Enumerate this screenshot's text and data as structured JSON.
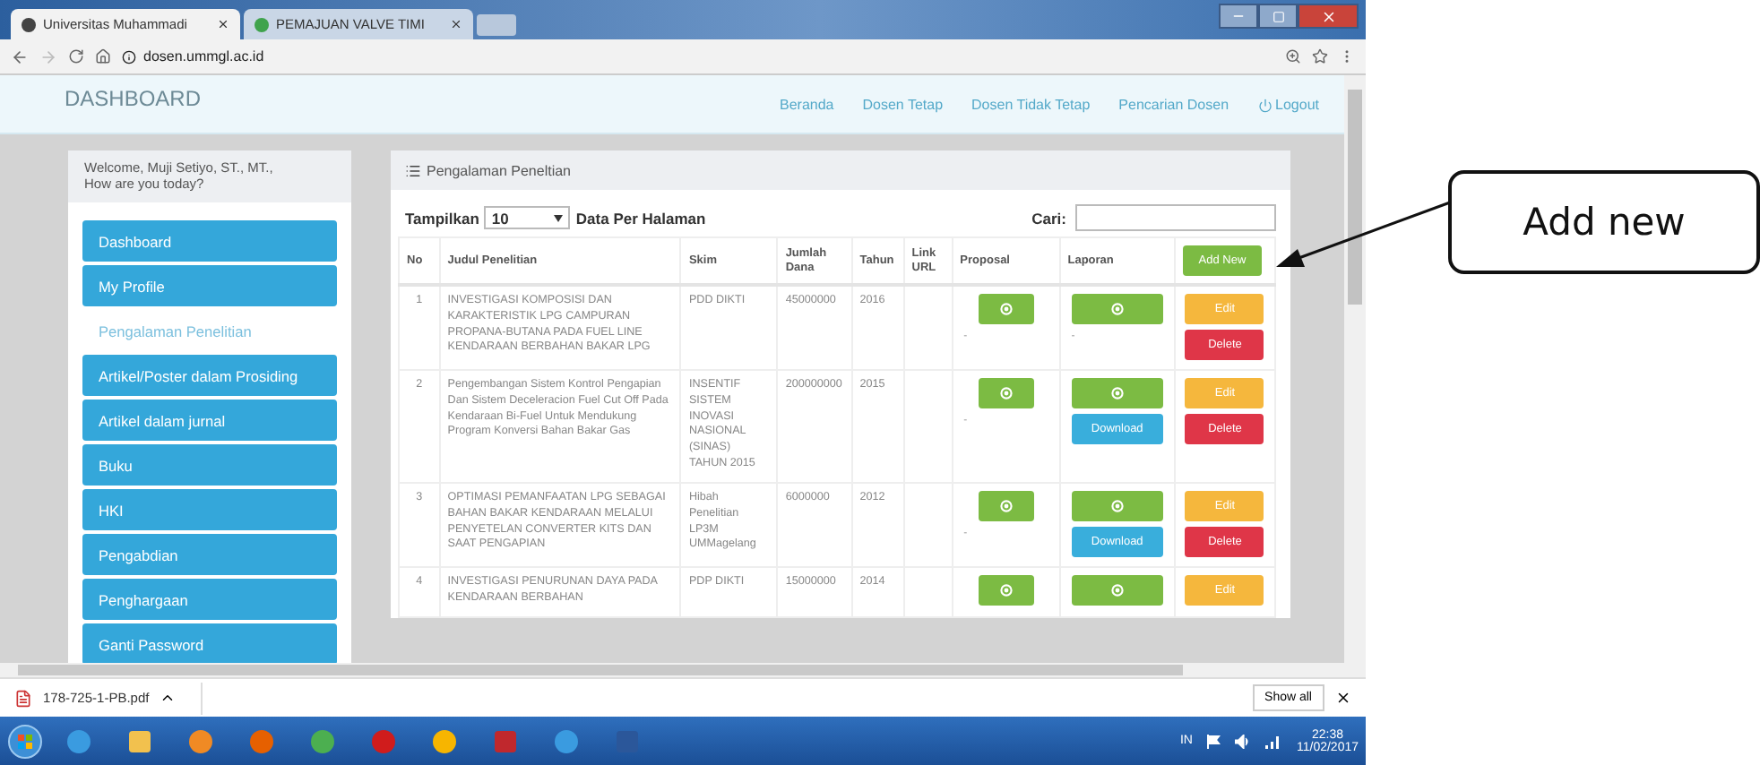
{
  "browser": {
    "tabs": [
      {
        "title": "Universitas Muhammadi",
        "selected": true
      },
      {
        "title": "PEMAJUAN VALVE TIMI",
        "selected": false
      }
    ],
    "address": "dosen.ummgl.ac.id"
  },
  "navbar": {
    "brand": "DASHBOARD",
    "links": [
      {
        "label": "Beranda",
        "kind": "text"
      },
      {
        "label": "Dosen Tetap",
        "kind": "text"
      },
      {
        "label": "Dosen Tidak Tetap",
        "kind": "text"
      },
      {
        "label": "Pencarian Dosen",
        "kind": "text"
      },
      {
        "label": "Logout",
        "kind": "power"
      }
    ]
  },
  "sidebar": {
    "welcome": "Welcome, Muji Setiyo, ST., MT.,",
    "greeting": "How are you today?",
    "items": [
      {
        "label": "Dashboard",
        "selected": false
      },
      {
        "label": "My Profile",
        "selected": false
      },
      {
        "label": "Pengalaman Penelitian",
        "selected": true
      },
      {
        "label": "Artikel/Poster dalam Prosiding",
        "selected": false
      },
      {
        "label": "Artikel dalam jurnal",
        "selected": false
      },
      {
        "label": "Buku",
        "selected": false
      },
      {
        "label": "HKI",
        "selected": false
      },
      {
        "label": "Pengabdian",
        "selected": false
      },
      {
        "label": "Penghargaan",
        "selected": false
      },
      {
        "label": "Ganti Password",
        "selected": false
      }
    ]
  },
  "panel": {
    "title": "Pengalaman Peneltian",
    "show_label": "Tampilkan",
    "page_size": "10",
    "per_page_label": "Data Per Halaman",
    "search_label": "Cari:",
    "add_button": "Add New",
    "columns": [
      "No",
      "Judul Penelitian",
      "Skim",
      "Jumlah Dana",
      "Tahun",
      "Link URL",
      "Proposal",
      "Laporan"
    ],
    "rows": [
      {
        "no": "1",
        "judul": "INVESTIGASI KOMPOSISI DAN KARAKTERISTIK LPG CAMPURAN PROPANA-BUTANA PADA FUEL LINE KENDARAAN BERBAHAN BAKAR LPG",
        "skim": "PDD DIKTI",
        "dana": "45000000",
        "tahun": "2016",
        "proposal": [
          {
            "kind": "view"
          }
        ],
        "proposal_note": "-",
        "laporan": [
          {
            "kind": "view"
          }
        ],
        "laporan_note": "-",
        "actions": [
          {
            "kind": "edit",
            "label": "Edit"
          },
          {
            "kind": "delete",
            "label": "Delete"
          }
        ]
      },
      {
        "no": "2",
        "judul": "Pengembangan Sistem Kontrol Pengapian Dan Sistem Deceleracion Fuel Cut Off Pada Kendaraan Bi-Fuel Untuk Mendukung Program Konversi Bahan Bakar Gas",
        "skim": "INSENTIF SISTEM INOVASI NASIONAL (SINAS) TAHUN 2015",
        "dana": "200000000",
        "tahun": "2015",
        "proposal": [
          {
            "kind": "view"
          }
        ],
        "proposal_note": "-",
        "laporan": [
          {
            "kind": "view"
          },
          {
            "kind": "download",
            "label": "Download"
          }
        ],
        "actions": [
          {
            "kind": "edit",
            "label": "Edit"
          },
          {
            "kind": "delete",
            "label": "Delete"
          }
        ]
      },
      {
        "no": "3",
        "judul": "OPTIMASI PEMANFAATAN LPG SEBAGAI BAHAN BAKAR KENDARAAN MELALUI PENYETELAN CONVERTER KITS DAN SAAT PENGAPIAN",
        "skim": "Hibah Penelitian LP3M UMMagelang",
        "dana": "6000000",
        "tahun": "2012",
        "proposal": [
          {
            "kind": "view"
          }
        ],
        "proposal_note": "-",
        "laporan": [
          {
            "kind": "view"
          },
          {
            "kind": "download",
            "label": "Download"
          }
        ],
        "actions": [
          {
            "kind": "edit",
            "label": "Edit"
          },
          {
            "kind": "delete",
            "label": "Delete"
          }
        ]
      },
      {
        "no": "4",
        "judul": "INVESTIGASI PENURUNAN DAYA PADA KENDARAAN BERBAHAN",
        "skim": "PDP DIKTI",
        "dana": "15000000",
        "tahun": "2014",
        "proposal": [
          {
            "kind": "view"
          }
        ],
        "laporan": [
          {
            "kind": "view"
          }
        ],
        "actions": [
          {
            "kind": "edit",
            "label": "Edit"
          }
        ]
      }
    ]
  },
  "downloads": {
    "file": "178-725-1-PB.pdf",
    "show_all": "Show all"
  },
  "taskbar": {
    "language": "IN",
    "time": "22:38",
    "date": "11/02/2017"
  },
  "callout": {
    "text": "Add new"
  }
}
